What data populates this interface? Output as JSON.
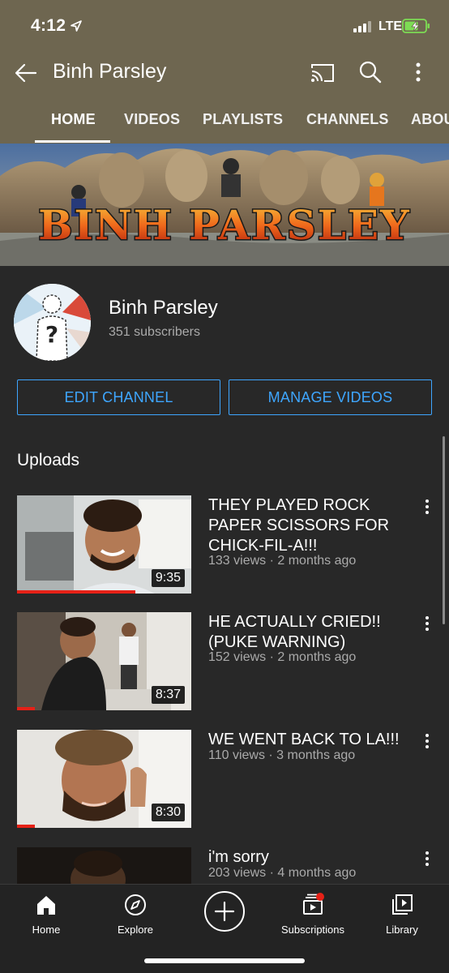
{
  "status_bar": {
    "time": "4:12",
    "network": "LTE"
  },
  "header": {
    "title": "Binh Parsley",
    "icons": [
      "back-arrow-icon",
      "cast-icon",
      "search-icon",
      "more-vert-icon"
    ]
  },
  "tabs": [
    {
      "label": "HOME",
      "active": true
    },
    {
      "label": "VIDEOS",
      "active": false
    },
    {
      "label": "PLAYLISTS",
      "active": false
    },
    {
      "label": "CHANNELS",
      "active": false
    },
    {
      "label": "ABOUT",
      "active": false
    }
  ],
  "banner": {
    "text": "BINH PARSLEY"
  },
  "channel": {
    "name": "Binh Parsley",
    "subscribers": "351 subscribers"
  },
  "actions": {
    "edit": "EDIT CHANNEL",
    "manage": "MANAGE VIDEOS"
  },
  "uploads": {
    "title": "Uploads",
    "videos": [
      {
        "title": "THEY PLAYED ROCK PAPER SCISSORS FOR CHICK-FIL-A!!!",
        "meta": "133 views · 2 months ago",
        "duration": "9:35",
        "progress": 0.68
      },
      {
        "title": "HE ACTUALLY CRIED!! (PUKE WARNING)",
        "meta": "152 views · 2 months ago",
        "duration": "8:37",
        "progress": 0.1
      },
      {
        "title": "WE WENT BACK TO LA!!!",
        "meta": "110 views · 3 months ago",
        "duration": "8:30",
        "progress": 0.1
      },
      {
        "title": "i'm sorry",
        "meta": "203 views · 4 months ago",
        "duration": "",
        "progress": 0
      }
    ]
  },
  "bottom_nav": {
    "home": "Home",
    "explore": "Explore",
    "subscriptions": "Subscriptions",
    "library": "Library"
  },
  "colors": {
    "header_bg": "#6e6650",
    "accent": "#3ea6ff",
    "progress": "#e62117",
    "bg": "#282828"
  }
}
